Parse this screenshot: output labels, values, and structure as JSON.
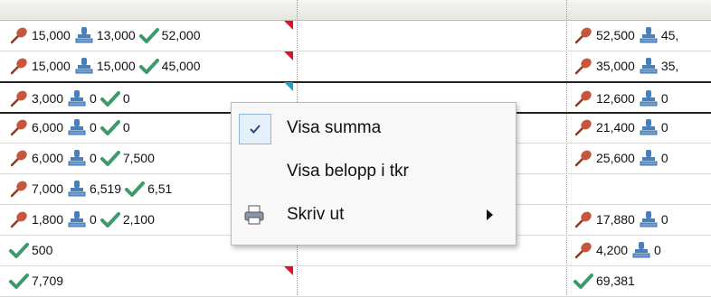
{
  "grid": {
    "rows": [
      {
        "left": [
          "15,000",
          "13,000",
          "52,000"
        ],
        "right": [
          "52,500",
          "45,"
        ]
      },
      {
        "left": [
          "15,000",
          "15,000",
          "45,000"
        ],
        "right": [
          "35,000",
          "35,"
        ]
      },
      {
        "left": [
          "3,000",
          "0",
          "0"
        ],
        "right": [
          "12,600",
          "0"
        ]
      },
      {
        "left": [
          "6,000",
          "0",
          "0"
        ],
        "right": [
          "21,400",
          "0"
        ]
      },
      {
        "left": [
          "6,000",
          "0",
          "7,500"
        ],
        "right": [
          "25,600",
          "0"
        ]
      },
      {
        "left": [
          "7,000",
          "6,519",
          "6,51"
        ],
        "right": []
      },
      {
        "left": [
          "1,800",
          "0",
          "2,100"
        ],
        "right": [
          "17,880",
          "0"
        ]
      },
      {
        "left": [
          "",
          "",
          "500"
        ],
        "right": [
          "4,200",
          "0"
        ]
      },
      {
        "left": [
          "",
          "",
          "7,709"
        ],
        "right": [
          "",
          "",
          "69,381"
        ]
      }
    ]
  },
  "icons": [
    "pin-icon",
    "stamp-icon",
    "check-icon"
  ],
  "colors": {
    "pin": "#c4573c",
    "stamp": "#4a7fb8",
    "check": "#3f9a6b",
    "marker": "#e0102a"
  },
  "context_menu": {
    "items": [
      {
        "label": "Visa summa",
        "checked": true
      },
      {
        "label": "Visa belopp i tkr"
      },
      {
        "label": "Skriv ut",
        "icon": "printer-icon",
        "submenu": true
      }
    ]
  }
}
